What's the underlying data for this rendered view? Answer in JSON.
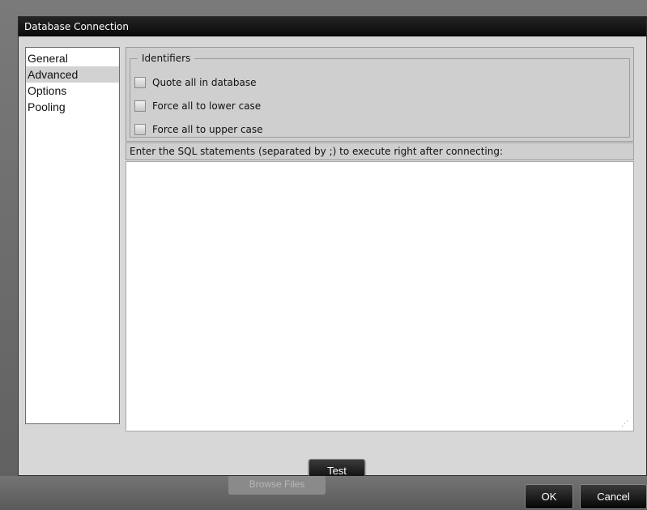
{
  "dialog": {
    "title": "Database Connection"
  },
  "nav": {
    "items": [
      {
        "label": "General",
        "selected": false
      },
      {
        "label": "Advanced",
        "selected": true
      },
      {
        "label": "Options",
        "selected": false
      },
      {
        "label": "Pooling",
        "selected": false
      }
    ]
  },
  "identifiers": {
    "legend": "Identifiers",
    "options": [
      {
        "label": "Quote all in database",
        "checked": false
      },
      {
        "label": "Force all to lower case",
        "checked": false
      },
      {
        "label": "Force all to upper case",
        "checked": false
      }
    ]
  },
  "sql": {
    "label": "Enter the SQL statements (separated by ;) to execute right after connecting:",
    "value": ""
  },
  "buttons": {
    "test": "Test",
    "ok": "OK",
    "cancel": "Cancel",
    "background": "Browse Files"
  },
  "icons": {
    "resize_grip": "resize-grip-icon"
  }
}
